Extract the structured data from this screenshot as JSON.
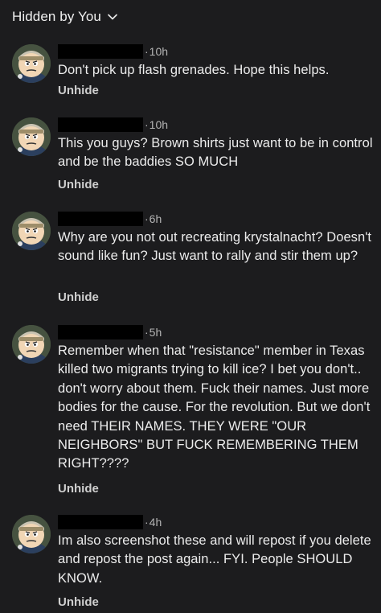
{
  "header": {
    "title": "Hidden by You",
    "chevron_icon": "chevron-down-icon"
  },
  "comments": [
    {
      "time": "10h",
      "text": "Don't pick up flash grenades. Hope this helps.",
      "action": "Unhide"
    },
    {
      "time": "10h",
      "text": "This you guys? Brown shirts just want to be in control and be the baddies SO MUCH",
      "action": "Unhide"
    },
    {
      "time": "6h",
      "text": "Why are you not out recreating krystalnacht? Doesn't sound like fun? Just want to rally and stir them up?",
      "action": "Unhide"
    },
    {
      "time": "5h",
      "text": "Remember when that \"resistance\" member in Texas killed two migrants trying to kill ice? I bet you don't.. don't worry about them. Fuck their names. Just more bodies for the cause. For the revolution.  But we don't need THEIR NAMES. THEY WERE \"OUR NEIGHBORS\" BUT FUCK REMEMBERING THEM RIGHT????",
      "action": "Unhide"
    },
    {
      "time": "4h",
      "text": "Im also screenshot these and will repost if you delete and repost the post again... FYI. People SHOULD KNOW.",
      "action": "Unhide"
    }
  ],
  "colors": {
    "background": "#1c1c1e",
    "text": "#ececec",
    "muted": "#b4b4b4",
    "redaction": "#000000"
  }
}
